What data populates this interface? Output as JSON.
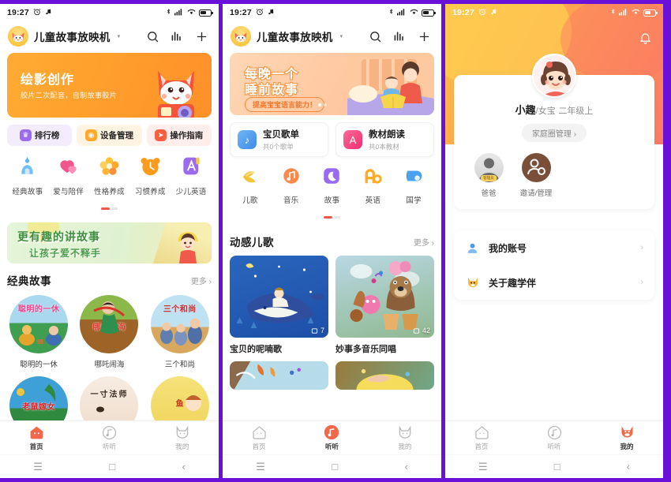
{
  "status_bar": {
    "time": "19:27",
    "alarm_icon": "alarm-icon",
    "music_icon": "music-note-icon",
    "bluetooth_icon": "bluetooth-icon",
    "signal_icon": "signal-bars-icon",
    "wifi_icon": "wifi-icon",
    "battery_icon": "battery-icon",
    "battery_text": "53"
  },
  "app": {
    "title": "儿童故事放映机",
    "caret": "▾",
    "search_icon": "search-icon",
    "chart_icon": "equalizer-icon",
    "add_icon": "plus-icon"
  },
  "nav_buttons": {
    "menu": "☰",
    "home": "□",
    "back": "‹"
  },
  "tabbar": {
    "items": [
      {
        "label": "首页",
        "icon": "home-icon",
        "active_panel1": true
      },
      {
        "label": "听听",
        "icon": "music-disc-icon",
        "active_panel2": true
      },
      {
        "label": "我的",
        "icon": "cat-face-icon",
        "active_panel3": true
      }
    ]
  },
  "panel1": {
    "banner": {
      "title": "绘影创作",
      "subtitle": "胶片二次配音，自制故事胶片",
      "art": "fox-mascot-with-camera"
    },
    "chips": [
      {
        "label": "排行榜",
        "icon": "trophy-icon",
        "bg": "#f2ecfd",
        "icon_bg": "#9a6bf0"
      },
      {
        "label": "设备管理",
        "icon": "device-icon",
        "bg": "#fff4e2",
        "icon_bg": "#ffa92b"
      },
      {
        "label": "操作指南",
        "icon": "compass-icon",
        "bg": "#ffeeeb",
        "icon_bg": "#f9603f"
      }
    ],
    "categories": [
      {
        "label": "经典故事",
        "icon": "castle-icon",
        "color": "#4ea6f0"
      },
      {
        "label": "爱与陪伴",
        "icon": "hearts-icon",
        "color": "#f0558c"
      },
      {
        "label": "性格养成",
        "icon": "flower-icon",
        "color": "#ffb02a"
      },
      {
        "label": "习惯养成",
        "icon": "clock-bear-icon",
        "color": "#ff9b1a"
      },
      {
        "label": "少儿英语",
        "icon": "letter-a-icon",
        "color": "#9a6bf0"
      }
    ],
    "pager": {
      "total": 2,
      "current": 1
    },
    "promo": {
      "line1": "更有趣的讲故事",
      "line2": "让孩子爱不释手",
      "art": "girl-under-umbrella"
    },
    "section": {
      "title": "经典故事",
      "more": "更多",
      "chevron": "›"
    },
    "stories_row1": [
      {
        "title": "聪明的一休",
        "overlay": "聪明的一休",
        "overlay_color": "#e8458d",
        "bg_top": "#a9d8ef",
        "bg_bottom": "#3f9e4f"
      },
      {
        "title": "哪吒闹海",
        "overlay": "哪吒闹海",
        "overlay_color": "#e03c2f",
        "bg_top": "#8cb84a",
        "bg_bottom": "#9e6326"
      },
      {
        "title": "三个和尚",
        "overlay": "三个和尚",
        "overlay_color": "#d32f2f",
        "bg_top": "#bfe2f2",
        "bg_bottom": "#d8a85e"
      }
    ],
    "stories_row2": [
      {
        "title": "老鼠嫁女",
        "overlay": "老鼠嫁女",
        "overlay_color": "#e02020",
        "bg_top": "#3fa0d8",
        "bg_bottom": "#2f8a3f"
      },
      {
        "title": "一寸法师",
        "overlay": "一寸法师",
        "overlay_color": "#3a2a20",
        "bg_top": "#f7ece2",
        "bg_bottom": "#efdccb"
      },
      {
        "title": "鱼",
        "overlay": "鱼",
        "overlay_color": "#c23a1e",
        "bg_top": "#f5e27a",
        "bg_bottom": "#f0d45a"
      }
    ]
  },
  "panel2": {
    "banner": {
      "line1": "每晚一个",
      "line2": "睡前故事",
      "pill": "提高宝宝语言能力！",
      "art": "mother-reading-to-child"
    },
    "pager": {
      "total": 2,
      "current": 1
    },
    "cards": [
      {
        "title": "宝贝歌单",
        "subtitle": "共0个歌单",
        "icon": "music-note-icon",
        "icon_bg": "#5aa9f5"
      },
      {
        "title": "教材朗读",
        "subtitle": "共0本教材",
        "icon": "letter-a-icon",
        "icon_bg": "#f4457f"
      }
    ],
    "categories": [
      {
        "label": "儿歌",
        "icon": "bird-icon",
        "color": "#f5c43a"
      },
      {
        "label": "音乐",
        "icon": "music-ball-icon",
        "color": "#fb8b4a"
      },
      {
        "label": "故事",
        "icon": "moon-icon",
        "color": "#9a6bf0"
      },
      {
        "label": "英语",
        "icon": "letters-ao-icon",
        "color": "#ffaa22"
      },
      {
        "label": "国学",
        "icon": "scroll-icon",
        "color": "#4aa3f0"
      }
    ],
    "cat_pager": {
      "total": 2,
      "current": 1
    },
    "section": {
      "title": "动感儿歌",
      "more": "更多",
      "chevron": "›"
    },
    "albums": [
      {
        "title": "宝贝的呢喃歌",
        "count": "7",
        "art": "whale-starry-night",
        "bg1": "#1e56b0",
        "bg2": "#2f7fd4"
      },
      {
        "title": "妙事多音乐同唱",
        "count": "42",
        "art": "bear-band-drums",
        "bg1": "#a9cfe0",
        "bg2": "#7fae8a"
      }
    ],
    "albums_row2": [
      {
        "art": "autumn-leaves-music",
        "bg1": "#a7d3e4",
        "bg2": "#cfe3ea"
      },
      {
        "art": "mermaid-golden",
        "bg1": "#b08a3a",
        "bg2": "#7fae9a"
      }
    ]
  },
  "panel3": {
    "bell_icon": "bell-icon",
    "profile": {
      "name": "小趣",
      "separator": "/",
      "gender": "女宝",
      "grade": "二年级上",
      "family_button": "家庭圈管理",
      "family_chevron": "›",
      "avatar": "girl-avatar"
    },
    "members": [
      {
        "label": "爸爸",
        "badge": "管理员",
        "avatar": "dad-silhouette"
      },
      {
        "label": "邀请/管理",
        "badge": "",
        "avatar": "invite-person-icon"
      }
    ],
    "menu": [
      {
        "label": "我的账号",
        "icon": "person-icon",
        "chevron": "›"
      },
      {
        "label": "关于趣学伴",
        "icon": "cat-face-icon",
        "chevron": "›"
      }
    ]
  }
}
